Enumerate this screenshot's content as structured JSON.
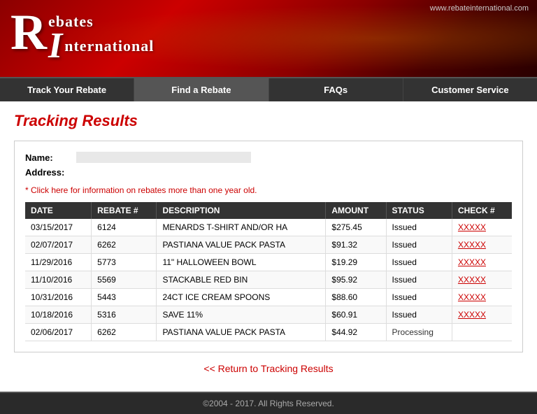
{
  "header": {
    "url": "www.rebateinternational.com",
    "logo_r": "R",
    "logo_rebates": "ebates",
    "logo_i": "I",
    "logo_international": "nternational"
  },
  "nav": {
    "items": [
      {
        "label": "Track Your Rebate",
        "active": false
      },
      {
        "label": "Find a Rebate",
        "active": true
      },
      {
        "label": "FAQs",
        "active": false
      },
      {
        "label": "Customer Service",
        "active": false
      }
    ]
  },
  "page": {
    "title": "Tracking Results",
    "name_label": "Name:",
    "address_label": "Address:",
    "info_link": "* Click here for information on rebates more than one year old.",
    "table": {
      "columns": [
        "DATE",
        "REBATE #",
        "DESCRIPTION",
        "AMOUNT",
        "STATUS",
        "CHECK #"
      ],
      "rows": [
        {
          "date": "03/15/2017",
          "rebate": "6124",
          "description": "MENARDS T-SHIRT AND/OR HA",
          "amount": "$275.45",
          "status": "Issued",
          "check": "XXXXX"
        },
        {
          "date": "02/07/2017",
          "rebate": "6262",
          "description": "PASTIANA VALUE PACK PASTA",
          "amount": "$91.32",
          "status": "Issued",
          "check": "XXXXX"
        },
        {
          "date": "11/29/2016",
          "rebate": "5773",
          "description": "11\" HALLOWEEN BOWL",
          "amount": "$19.29",
          "status": "Issued",
          "check": "XXXXX"
        },
        {
          "date": "11/10/2016",
          "rebate": "5569",
          "description": "STACKABLE RED BIN",
          "amount": "$95.92",
          "status": "Issued",
          "check": "XXXXX"
        },
        {
          "date": "10/31/2016",
          "rebate": "5443",
          "description": "24CT ICE CREAM SPOONS",
          "amount": "$88.60",
          "status": "Issued",
          "check": "XXXXX"
        },
        {
          "date": "10/18/2016",
          "rebate": "5316",
          "description": "SAVE 11%",
          "amount": "$60.91",
          "status": "Issued",
          "check": "XXXXX"
        },
        {
          "date": "02/06/2017",
          "rebate": "6262",
          "description": "PASTIANA VALUE PACK PASTA",
          "amount": "$44.92",
          "status": "Processing",
          "check": ""
        }
      ]
    },
    "return_link": "<< Return to Tracking Results"
  },
  "footer": {
    "text": "©2004 - 2017. All Rights Reserved."
  }
}
